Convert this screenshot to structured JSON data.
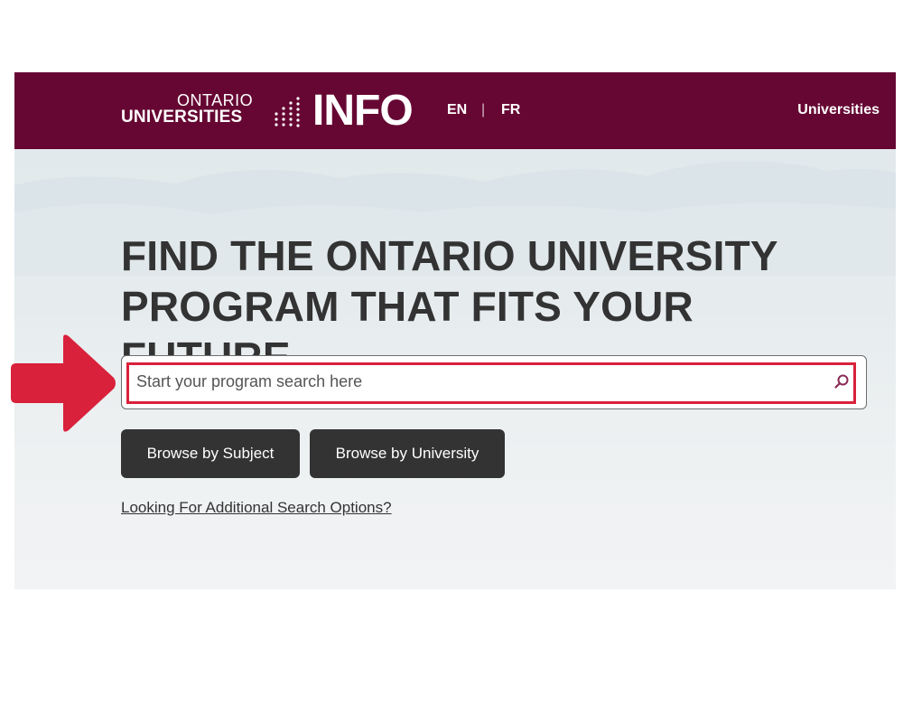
{
  "header": {
    "logo": {
      "line1": "ONTARIO",
      "line2": "UNIVERSITIES",
      "wordmark": "INFO"
    },
    "languages": {
      "en": "EN",
      "separator": "|",
      "fr": "FR"
    },
    "nav_right": "Universities"
  },
  "hero": {
    "title_line1": "FIND THE ONTARIO UNIVERSITY",
    "title_line2": "PROGRAM THAT FITS YOUR FUTURE"
  },
  "search": {
    "placeholder": "Start your program search here",
    "value": "",
    "icon": "search-icon"
  },
  "buttons": {
    "browse_subject": "Browse by Subject",
    "browse_university": "Browse by University"
  },
  "links": {
    "additional_options": "Looking For Additional Search Options?"
  },
  "annotation": {
    "arrow_icon": "arrow-right-icon",
    "color": "#d9213b"
  },
  "colors": {
    "header_bg": "#660733",
    "button_bg": "#333333",
    "text_dark": "#333333",
    "highlight": "#d9213b"
  }
}
